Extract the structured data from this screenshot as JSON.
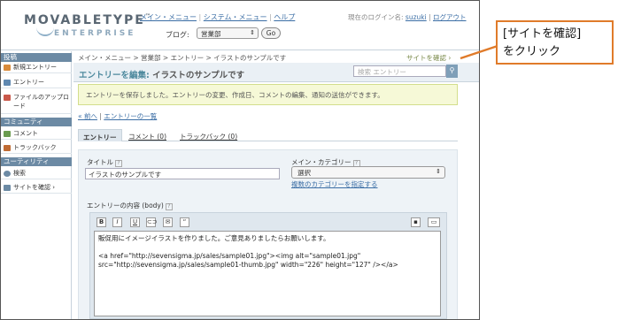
{
  "header": {
    "logo_main": "MOVABLETYPE",
    "logo_tm": "™",
    "logo_sub": "ENTERPRISE",
    "nav": {
      "main_menu": "メイン・メニュー",
      "sep": " | ",
      "system_menu": "システム・メニュー",
      "help": "ヘルプ"
    },
    "login_label": "現在のログイン名:",
    "login_user": "suzuki",
    "logout": "ログアウト",
    "blog_label": "ブログ:",
    "blog_value": "営業部",
    "go_label": "Go"
  },
  "sidebar": {
    "sections": [
      {
        "title": "投稿",
        "items": [
          {
            "label": "新規エントリー",
            "icon": "new-entry-icon",
            "color": "#d88a3a"
          },
          {
            "label": "エントリー",
            "icon": "entries-icon",
            "color": "#5f88b0"
          },
          {
            "label": "ファイルのアップロード",
            "icon": "upload-icon",
            "color": "#c9584a"
          }
        ]
      },
      {
        "title": "コミュニティ",
        "items": [
          {
            "label": "コメント",
            "icon": "comment-icon",
            "color": "#6a9b4f"
          },
          {
            "label": "トラックバック",
            "icon": "trackback-icon",
            "color": "#c06b33"
          }
        ]
      },
      {
        "title": "ユーティリティ",
        "items": [
          {
            "label": "検索",
            "icon": "search-icon",
            "color": "#6c8aa4"
          },
          {
            "label": "サイトを確認 ›",
            "icon": "site-icon",
            "color": "#6c8aa4"
          }
        ]
      }
    ]
  },
  "main": {
    "breadcrumb": "メイン・メニュー > 営業部 > エントリー > イラストのサンプルです",
    "site_confirm": "サイトを確認 ›",
    "page_title_prefix": "エントリーを編集:",
    "page_title_entry": "イラストのサンプルです",
    "search_placeholder": "検索 エントリー",
    "message": "エントリーを保存しました。エントリーの変更、作成日、コメントの編集、通知の送信ができます。",
    "prev_link": "« 前へ",
    "prev_sep": " | ",
    "list_link": "エントリーの一覧",
    "tabs": [
      {
        "label": "エントリー",
        "active": true
      },
      {
        "label": "コメント (0)",
        "active": false
      },
      {
        "label": "トラックバック (0)",
        "active": false
      }
    ],
    "title_label": "タイトル",
    "title_value": "イラストのサンプルです",
    "category_label": "メイン・カテゴリー",
    "category_value": "選択",
    "multi_category_link": "複数のカテゴリーを指定する",
    "body_label": "エントリーの内容 (body)",
    "help_mark": "?",
    "toolbar": [
      "B",
      "I",
      "U",
      "link",
      "mail",
      "quote"
    ],
    "body_text": "販促用にイメージイラストを作りました。ご意見ありましたらお願いします。\n\n<a href=\"http://sevensigma.jp/sales/sample01.jpg\"><img alt=\"sample01.jpg\" src=\"http://sevensigma.jp/sales/sample01-thumb.jpg\" width=\"226\" height=\"127\" /></a>"
  },
  "callout": {
    "line1": "[サイトを確認]",
    "line2": "をクリック",
    "color": "#e07b2a"
  }
}
